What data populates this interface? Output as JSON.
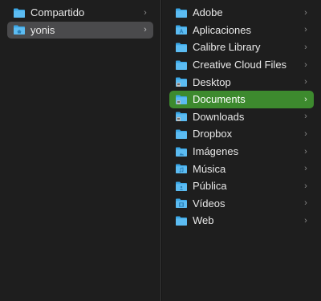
{
  "colors": {
    "background": "#1e1e1e",
    "selection_inactive": "#4a4a4c",
    "selection_active": "#3d8a2e",
    "folder_blue": "#3aa7e6"
  },
  "column1": {
    "items": [
      {
        "label": "Compartido",
        "icon": "folder-icon"
      },
      {
        "label": "yonis",
        "icon": "home-folder-icon"
      }
    ]
  },
  "column2": {
    "items": [
      {
        "label": "Adobe",
        "icon": "folder-icon"
      },
      {
        "label": "Aplicaciones",
        "icon": "applications-folder-icon"
      },
      {
        "label": "Calibre Library",
        "icon": "folder-icon"
      },
      {
        "label": "Creative Cloud Files",
        "icon": "folder-icon"
      },
      {
        "label": "Desktop",
        "icon": "desktop-folder-icon"
      },
      {
        "label": "Documents",
        "icon": "documents-folder-icon"
      },
      {
        "label": "Downloads",
        "icon": "downloads-folder-icon"
      },
      {
        "label": "Dropbox",
        "icon": "folder-icon"
      },
      {
        "label": "Imágenes",
        "icon": "pictures-folder-icon"
      },
      {
        "label": "Música",
        "icon": "music-folder-icon"
      },
      {
        "label": "Pública",
        "icon": "public-folder-icon"
      },
      {
        "label": "Vídeos",
        "icon": "movies-folder-icon"
      },
      {
        "label": "Web",
        "icon": "folder-icon"
      }
    ]
  },
  "chevron_glyph": "›"
}
